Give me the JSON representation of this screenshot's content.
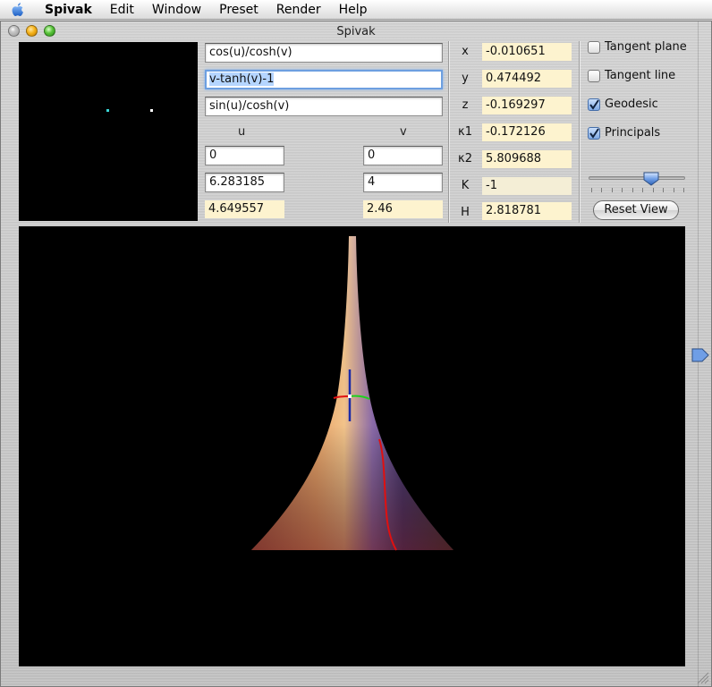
{
  "menubar": {
    "app_name": "Spivak",
    "items": [
      "Edit",
      "Window",
      "Preset",
      "Render",
      "Help"
    ]
  },
  "window": {
    "title": "Spivak"
  },
  "equations": {
    "x": "cos(u)/cosh(v)",
    "y": "v-tanh(v)-1",
    "z": "sin(u)/cosh(v)"
  },
  "params": {
    "u_label": "u",
    "v_label": "v",
    "u_min": "0",
    "v_min": "0",
    "u_max": "6.283185",
    "v_max": "4",
    "u_current": "4.649557",
    "v_current": "2.46"
  },
  "readouts": [
    {
      "label": "x",
      "value": "-0.010651"
    },
    {
      "label": "y",
      "value": "0.474492"
    },
    {
      "label": "z",
      "value": "-0.169297"
    },
    {
      "label": "κ1",
      "value": "-0.172126"
    },
    {
      "label": "κ2",
      "value": "5.809688"
    },
    {
      "label": "K",
      "value": "-1"
    },
    {
      "label": "H",
      "value": "2.818781"
    }
  ],
  "options": {
    "tangent_plane": {
      "label": "Tangent plane",
      "checked": false
    },
    "tangent_line": {
      "label": "Tangent line",
      "checked": false
    },
    "geodesic": {
      "label": "Geodesic",
      "checked": true
    },
    "principals": {
      "label": "Principals",
      "checked": true
    }
  },
  "buttons": {
    "reset_view": "Reset View"
  },
  "colors": {
    "readout_bg": "#fdf3cf",
    "checkbox_on": "#7fa9e4",
    "view_bg": "#000000"
  }
}
